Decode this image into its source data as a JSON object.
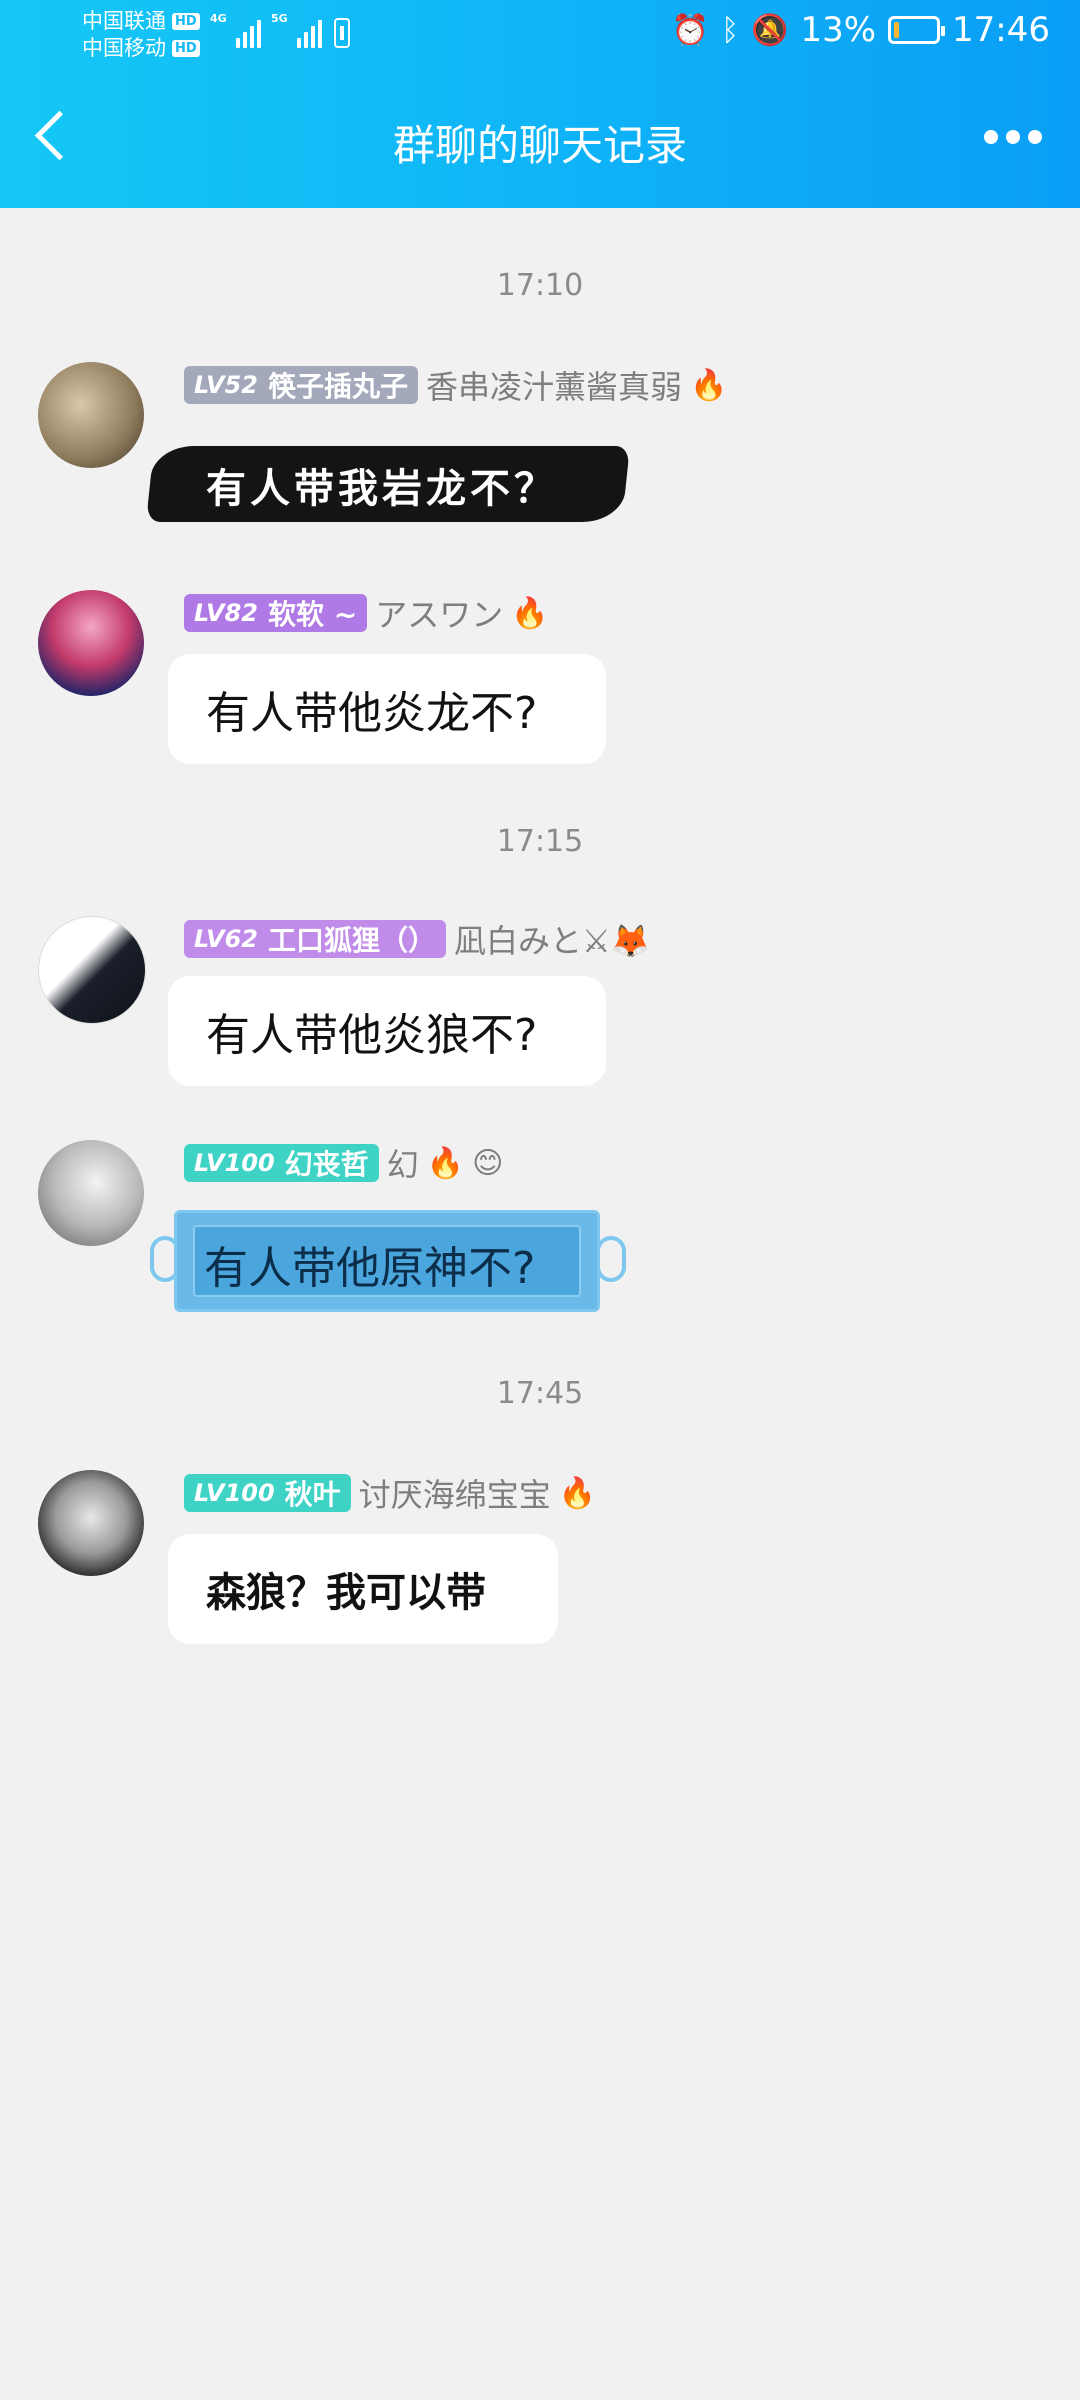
{
  "status_bar": {
    "carrier1": "中国联通",
    "carrier2": "中国移动",
    "hd": "HD",
    "net1": "4G",
    "net2": "5G",
    "battery_percent": "13%",
    "battery_level": 0.13,
    "time": "17:46"
  },
  "header": {
    "title": "群聊的聊天记录"
  },
  "messages": [
    {
      "timestamp": "17:10",
      "level": "LV52",
      "nickname": "筷子插丸子",
      "title_name": "香串凌汁薰酱真弱",
      "badge_color": "#a3a9bb",
      "text": "有人带我岩龙不？",
      "style": "ink"
    },
    {
      "level": "LV82",
      "nickname": "软软 ~",
      "title_name": "アスワン",
      "badge_color": "#b07ae6",
      "text": "有人带他炎龙不?",
      "style": "plain"
    },
    {
      "timestamp": "17:15",
      "level": "LV62",
      "nickname": "工口狐狸（）",
      "title_name": "凪白みと⚔🦊",
      "badge_color": "#c08be9",
      "text": "有人带他炎狼不?",
      "style": "plain"
    },
    {
      "level": "LV100",
      "nickname": "幻丧哲",
      "title_name": "幻",
      "badge_color": "#3fd3c6",
      "text": "有人带他原神不?",
      "style": "mask"
    },
    {
      "timestamp": "17:45",
      "level": "LV100",
      "nickname": "秋叶",
      "title_name": "讨厌海绵宝宝",
      "badge_color": "#3fd3c6",
      "text": "森狼？我可以带",
      "style": "plain"
    }
  ],
  "colors": {
    "header_gradient_start": "#15c8f5",
    "header_gradient_end": "#0a9ef6",
    "background": "#f1f1f1"
  },
  "icons": [
    "back-arrow-icon",
    "more-icon",
    "alarm-icon",
    "bluetooth-icon",
    "mute-icon",
    "battery-icon",
    "fire-icon",
    "smile-emoji-icon"
  ]
}
